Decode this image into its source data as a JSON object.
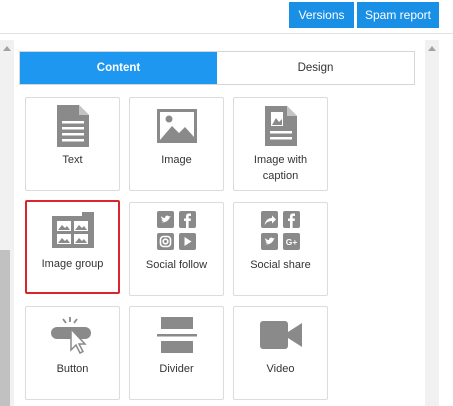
{
  "header": {
    "versions_label": "Versions",
    "spam_report_label": "Spam report"
  },
  "tabs": [
    {
      "label": "Content",
      "active": true
    },
    {
      "label": "Design",
      "active": false
    }
  ],
  "blocks": [
    {
      "label": "Text",
      "icon": "text-icon"
    },
    {
      "label": "Image",
      "icon": "image-icon"
    },
    {
      "label": "Image with caption",
      "icon": "image-caption-icon"
    },
    {
      "label": "Image group",
      "icon": "image-group-icon",
      "selected": true
    },
    {
      "label": "Social follow",
      "icon": "social-follow-icon"
    },
    {
      "label": "Social share",
      "icon": "social-share-icon"
    },
    {
      "label": "Button",
      "icon": "button-icon"
    },
    {
      "label": "Divider",
      "icon": "divider-icon"
    },
    {
      "label": "Video",
      "icon": "video-icon"
    }
  ],
  "colors": {
    "accent": "#1e97f0",
    "icon": "#8a8a8a",
    "selection": "#d8262c"
  }
}
